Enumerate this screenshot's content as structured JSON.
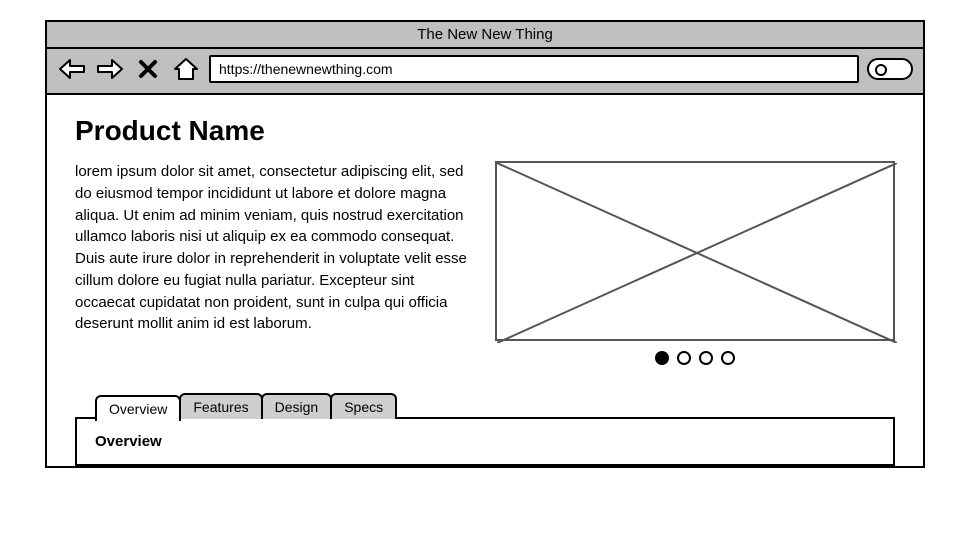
{
  "window": {
    "title": "The New New Thing",
    "url": "https://thenewnewthing.com"
  },
  "page": {
    "heading": "Product Name",
    "lorem": "lorem ipsum dolor sit amet, consectetur adipiscing elit, sed do eiusmod tempor incididunt ut labore et dolore magna aliqua. Ut enim ad minim veniam, quis nostrud exercitation ullamco laboris nisi ut aliquip ex ea commodo consequat. Duis aute irure dolor in reprehenderit in voluptate velit esse cillum dolore eu fugiat nulla pariatur. Excepteur sint occaecat cupidatat non proident, sunt in culpa qui officia deserunt mollit anim id est laborum."
  },
  "carousel": {
    "slide_count": 4,
    "active_index": 0
  },
  "tabs": {
    "items": [
      {
        "label": "Overview"
      },
      {
        "label": "Features"
      },
      {
        "label": "Design"
      },
      {
        "label": "Specs"
      }
    ],
    "active_index": 0,
    "panel_heading": "Overview"
  }
}
